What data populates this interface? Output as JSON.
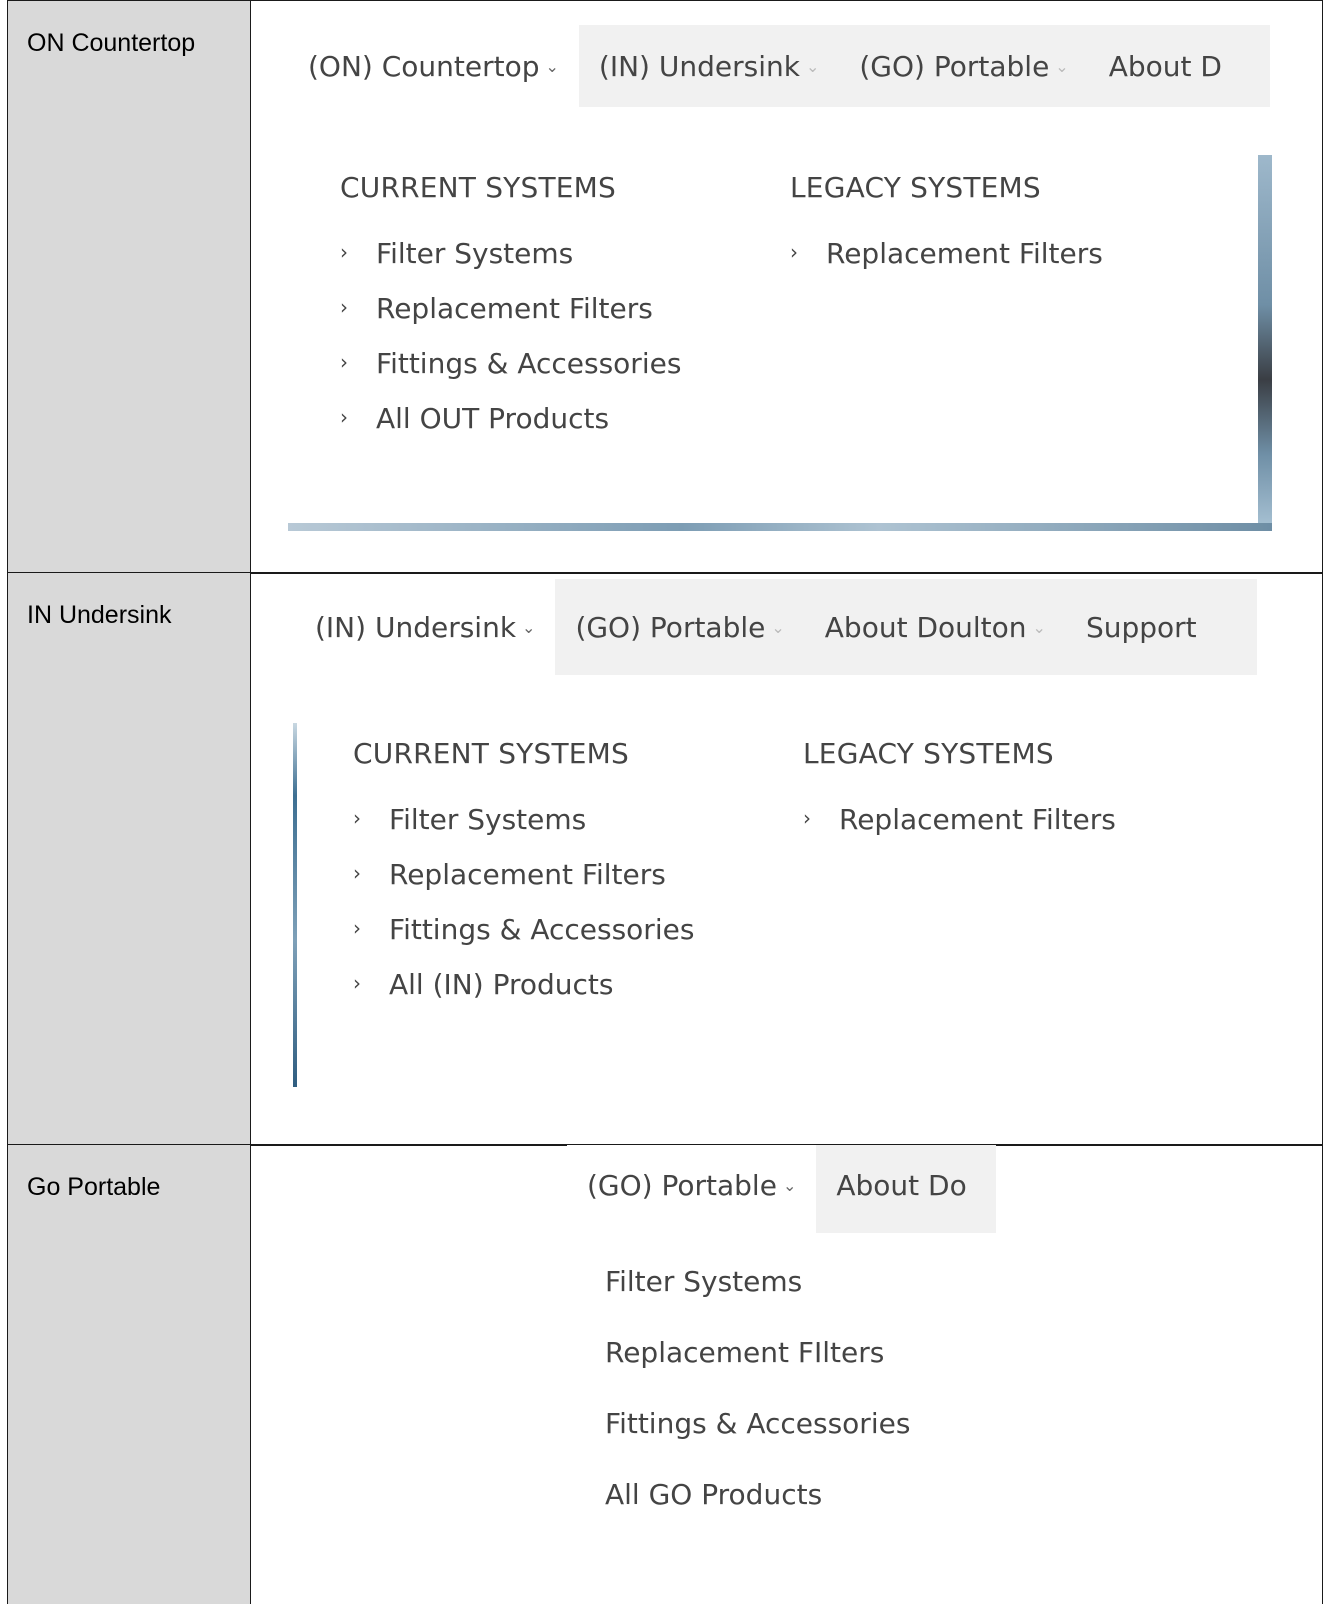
{
  "rows": [
    {
      "label": "ON Countertop",
      "nav": [
        {
          "label": "(ON) Countertop",
          "chevron": "⌄"
        },
        {
          "label": "(IN) Undersink",
          "chevron": "⌄"
        },
        {
          "label": "(GO) Portable",
          "chevron": "⌄"
        },
        {
          "label": "About D"
        }
      ],
      "current_title": "CURRENT SYSTEMS",
      "legacy_title": "LEGACY SYSTEMS",
      "current_links": [
        "Filter Systems",
        "Replacement Filters",
        "Fittings & Accessories",
        "All OUT Products"
      ],
      "legacy_links": [
        "Replacement Filters"
      ]
    },
    {
      "label": "IN Undersink",
      "nav": [
        {
          "label": "(IN) Undersink",
          "chevron": "⌄"
        },
        {
          "label": "(GO) Portable",
          "chevron": "⌄"
        },
        {
          "label": "About Doulton",
          "chevron": "⌄"
        },
        {
          "label": "Support"
        }
      ],
      "current_title": "CURRENT SYSTEMS",
      "legacy_title": "LEGACY SYSTEMS",
      "current_links": [
        "Filter Systems",
        "Replacement Filters",
        "Fittings & Accessories",
        "All (IN) Products"
      ],
      "legacy_links": [
        "Replacement Filters"
      ]
    },
    {
      "label": "Go Portable",
      "nav": [
        {
          "label": "(GO) Portable",
          "chevron": "⌄"
        },
        {
          "label": "About Do"
        }
      ],
      "links": [
        "Filter Systems",
        "Replacement FIlters",
        "Fittings & Accessories",
        "All GO Products"
      ]
    }
  ],
  "link_arrow": "›",
  "icons": {
    "chevron": "chevron-down-icon",
    "arrow": "chevron-right-icon"
  }
}
